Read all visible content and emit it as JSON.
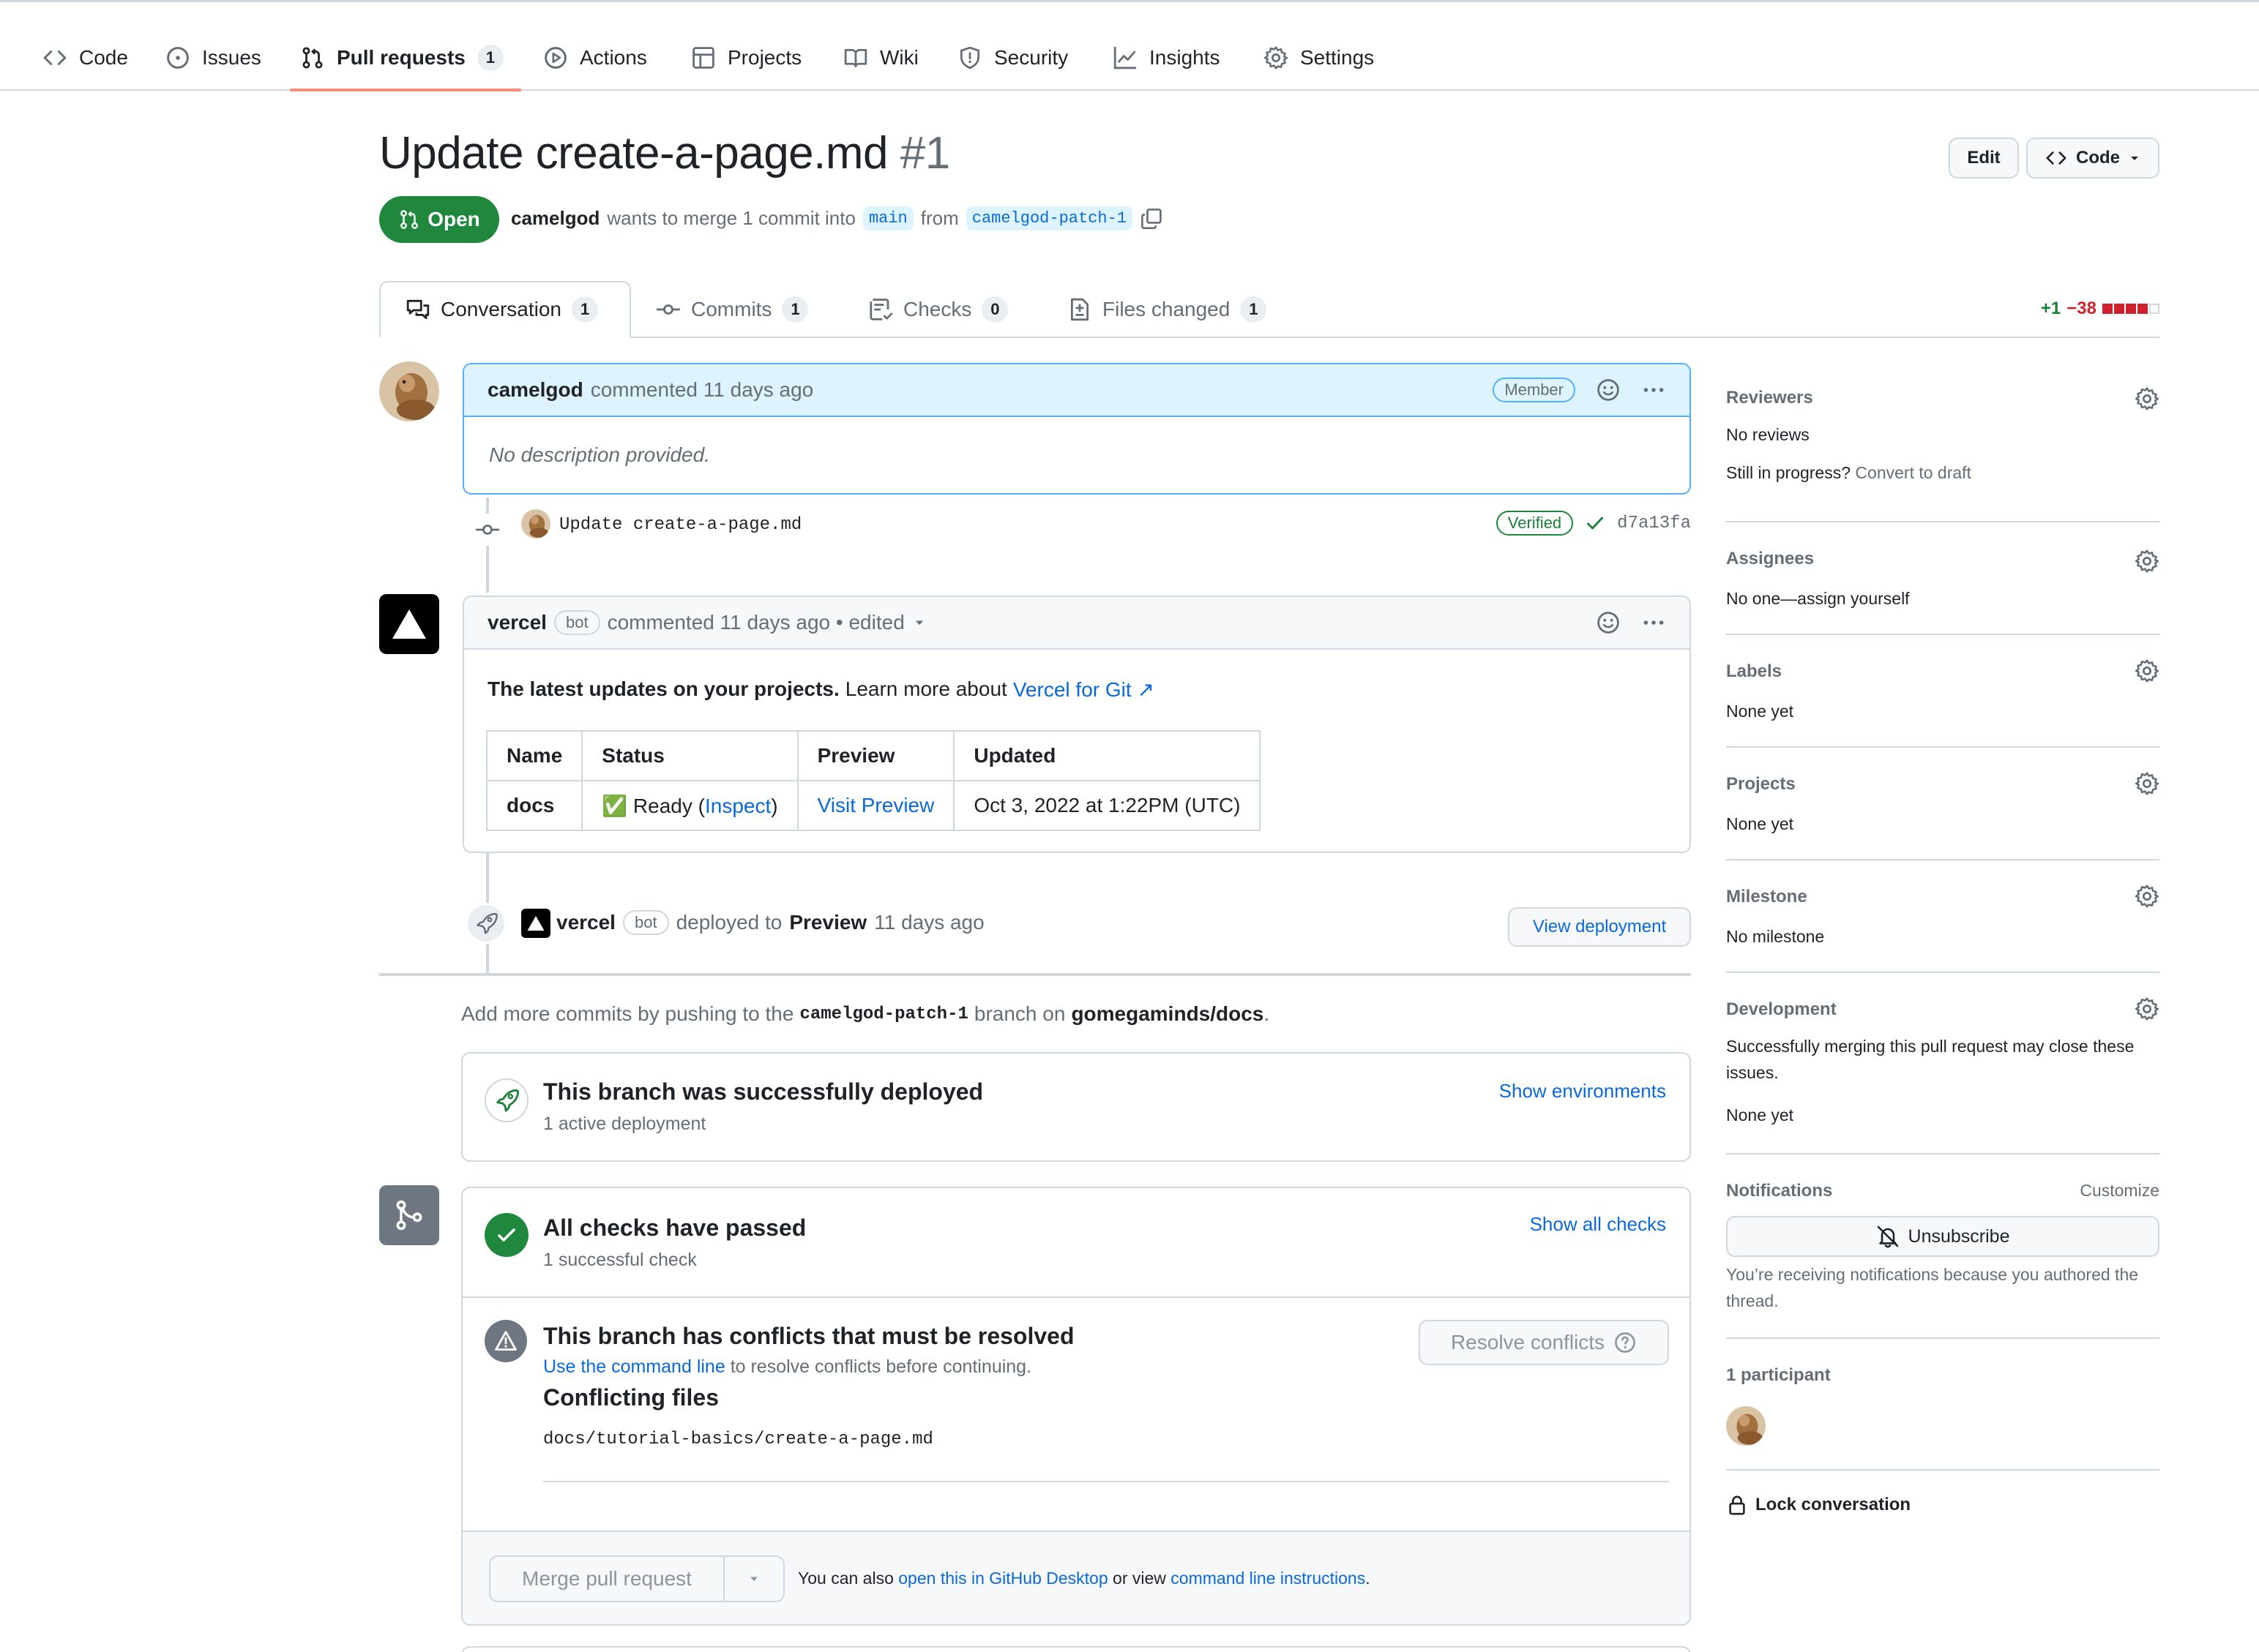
{
  "nav": {
    "tabs": [
      {
        "label": "Code",
        "icon": "code-icon"
      },
      {
        "label": "Issues",
        "icon": "issue-opened-icon"
      },
      {
        "label": "Pull requests",
        "icon": "git-pull-request-icon",
        "count": "1"
      },
      {
        "label": "Actions",
        "icon": "play-icon"
      },
      {
        "label": "Projects",
        "icon": "table-icon"
      },
      {
        "label": "Wiki",
        "icon": "book-icon"
      },
      {
        "label": "Security",
        "icon": "shield-icon"
      },
      {
        "label": "Insights",
        "icon": "graph-icon"
      },
      {
        "label": "Settings",
        "icon": "gear-icon"
      }
    ]
  },
  "header": {
    "title": "Update create-a-page.md",
    "number": "#1",
    "edit_label": "Edit",
    "code_label": "Code",
    "state": "Open",
    "author": "camelgod",
    "merge_text": "wants to merge 1 commit into",
    "base_branch": "main",
    "from_text": "from",
    "head_branch": "camelgod-patch-1"
  },
  "prtabs": {
    "conversation": {
      "label": "Conversation",
      "count": "1"
    },
    "commits": {
      "label": "Commits",
      "count": "1"
    },
    "checks": {
      "label": "Checks",
      "count": "0"
    },
    "files": {
      "label": "Files changed",
      "count": "1"
    },
    "additions": "+1",
    "deletions": "−38"
  },
  "comment1": {
    "author": "camelgod",
    "action": "commented 11 days ago",
    "badge": "Member",
    "body": "No description provided."
  },
  "commit": {
    "message": "Update create-a-page.md",
    "verified": "Verified",
    "sha": "d7a13fa"
  },
  "comment2": {
    "author": "vercel",
    "bot_badge": "bot",
    "action": "commented 11 days ago • edited",
    "intro_bold": "The latest updates on your projects.",
    "intro_rest": "Learn more about",
    "intro_link": "Vercel for Git ↗",
    "table": {
      "headers": [
        "Name",
        "Status",
        "Preview",
        "Updated"
      ],
      "row": {
        "name": "docs",
        "status_emoji": "✅",
        "status_text": "Ready (",
        "status_link": "Inspect",
        "status_close": ")",
        "preview": "Visit Preview",
        "updated": "Oct 3, 2022 at 1:22PM (UTC)"
      }
    }
  },
  "deploy_event": {
    "author": "vercel",
    "bot_badge": "bot",
    "text_before": "deployed to",
    "env": "Preview",
    "time": "11 days ago",
    "button": "View deployment"
  },
  "push_hint": {
    "before": "Add more commits by pushing to the",
    "branch": "camelgod-patch-1",
    "middle": "branch on",
    "repo": "gomegaminds/docs",
    "end": "."
  },
  "deploy_box": {
    "title": "This branch was successfully deployed",
    "sub": "1 active deployment",
    "link": "Show environments"
  },
  "checks_box": {
    "title": "All checks have passed",
    "sub": "1 successful check",
    "link": "Show all checks"
  },
  "conflict_box": {
    "title": "This branch has conflicts that must be resolved",
    "link": "Use the command line",
    "rest": "to resolve conflicts before continuing.",
    "files_title": "Conflicting files",
    "file": "docs/tutorial-basics/create-a-page.md",
    "button": "Resolve conflicts"
  },
  "merge": {
    "button": "Merge pull request",
    "hint_before": "You can also",
    "hint_link1": "open this in GitHub Desktop",
    "hint_middle": "or view",
    "hint_link2": "command line instructions",
    "hint_end": "."
  },
  "sidebar": {
    "reviewers": {
      "title": "Reviewers",
      "value": "No reviews",
      "progress": "Still in progress?",
      "progress_link": "Convert to draft"
    },
    "assignees": {
      "title": "Assignees",
      "value": "No one—assign yourself"
    },
    "labels": {
      "title": "Labels",
      "value": "None yet"
    },
    "projects": {
      "title": "Projects",
      "value": "None yet"
    },
    "milestone": {
      "title": "Milestone",
      "value": "No milestone"
    },
    "development": {
      "title": "Development",
      "desc": "Successfully merging this pull request may close these issues.",
      "value": "None yet"
    },
    "notifications": {
      "title": "Notifications",
      "customize": "Customize",
      "button": "Unsubscribe",
      "reason": "You’re receiving notifications because you authored the thread."
    },
    "participants": {
      "title": "1 participant"
    },
    "lock": "Lock conversation"
  },
  "colors": {
    "accent": "#0969da",
    "success": "#1f883d",
    "danger": "#cf222e",
    "nav_underline": "#fd8c73"
  }
}
